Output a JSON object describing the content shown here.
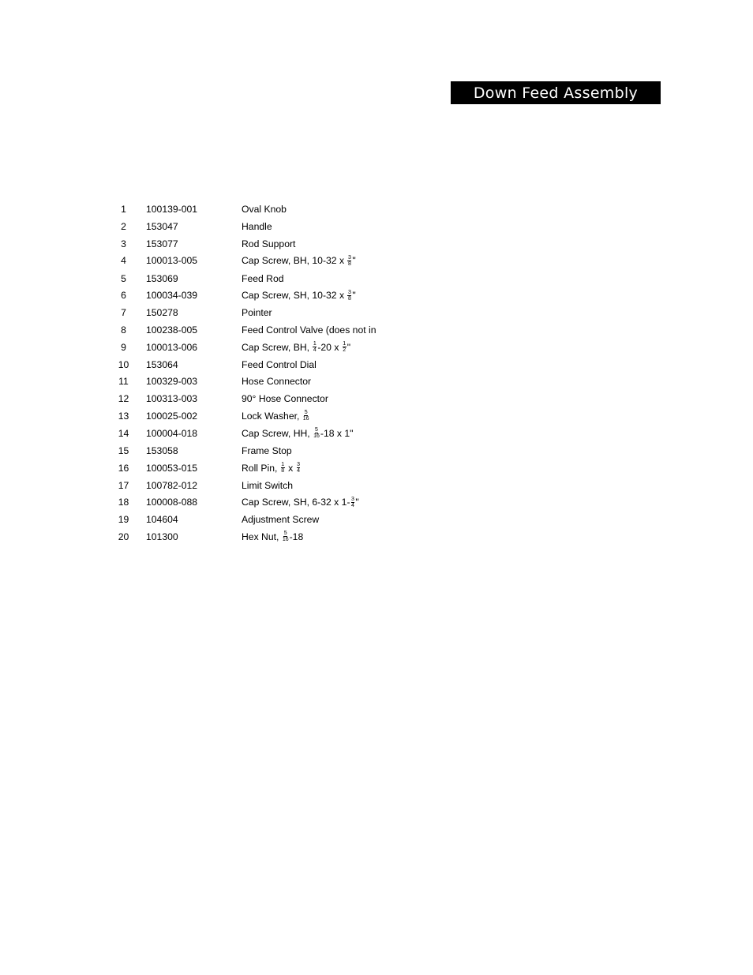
{
  "title": "Down Feed Assembly",
  "parts": [
    {
      "item": "1",
      "part_number": "100139-001",
      "description": [
        {
          "t": "Oval Knob"
        }
      ]
    },
    {
      "item": "2",
      "part_number": "153047",
      "description": [
        {
          "t": "Handle"
        }
      ]
    },
    {
      "item": "3",
      "part_number": "153077",
      "description": [
        {
          "t": "Rod Support"
        }
      ]
    },
    {
      "item": "4",
      "part_number": "100013-005",
      "description": [
        {
          "t": "Cap Screw, BH, 10-32 x "
        },
        {
          "n": "3",
          "d": "8"
        },
        {
          "t": "\""
        }
      ]
    },
    {
      "item": "5",
      "part_number": "153069",
      "description": [
        {
          "t": "Feed Rod"
        }
      ]
    },
    {
      "item": "6",
      "part_number": "100034-039",
      "description": [
        {
          "t": "Cap Screw, SH, 10-32 x "
        },
        {
          "n": "3",
          "d": "8"
        },
        {
          "t": "\""
        }
      ]
    },
    {
      "item": "7",
      "part_number": "150278",
      "description": [
        {
          "t": "Pointer"
        }
      ]
    },
    {
      "item": "8",
      "part_number": "100238-005",
      "description": [
        {
          "t": "Feed Control Valve (does not in"
        }
      ]
    },
    {
      "item": "9",
      "part_number": "100013-006",
      "description": [
        {
          "t": "Cap Screw, BH, "
        },
        {
          "n": "1",
          "d": "4"
        },
        {
          "t": "-20 x "
        },
        {
          "n": "1",
          "d": "2"
        },
        {
          "t": "\""
        }
      ]
    },
    {
      "item": "10",
      "part_number": "153064",
      "description": [
        {
          "t": "Feed Control Dial"
        }
      ]
    },
    {
      "item": "11",
      "part_number": "100329-003",
      "description": [
        {
          "t": "Hose Connector"
        }
      ]
    },
    {
      "item": "12",
      "part_number": "100313-003",
      "description": [
        {
          "t": "90° Hose Connector"
        }
      ]
    },
    {
      "item": "13",
      "part_number": "100025-002",
      "description": [
        {
          "t": "Lock Washer, "
        },
        {
          "n": "5",
          "d": "16"
        }
      ]
    },
    {
      "item": "14",
      "part_number": "100004-018",
      "description": [
        {
          "t": "Cap Screw, HH, "
        },
        {
          "n": "5",
          "d": "16"
        },
        {
          "t": "-18 x 1\""
        }
      ]
    },
    {
      "item": "15",
      "part_number": "153058",
      "description": [
        {
          "t": "Frame Stop"
        }
      ]
    },
    {
      "item": "16",
      "part_number": "100053-015",
      "description": [
        {
          "t": "Roll Pin, "
        },
        {
          "n": "1",
          "d": "8"
        },
        {
          "t": " x "
        },
        {
          "n": "3",
          "d": "4"
        }
      ]
    },
    {
      "item": "17",
      "part_number": "100782-012",
      "description": [
        {
          "t": "Limit Switch"
        }
      ]
    },
    {
      "item": "18",
      "part_number": "100008-088",
      "description": [
        {
          "t": "Cap Screw, SH, 6-32 x 1-"
        },
        {
          "n": "3",
          "d": "4"
        },
        {
          "t": "\""
        }
      ]
    },
    {
      "item": "19",
      "part_number": "104604",
      "description": [
        {
          "t": "Adjustment Screw"
        }
      ]
    },
    {
      "item": "20",
      "part_number": "101300",
      "description": [
        {
          "t": "Hex Nut, "
        },
        {
          "n": "5",
          "d": "16"
        },
        {
          "t": "-18"
        }
      ]
    }
  ]
}
